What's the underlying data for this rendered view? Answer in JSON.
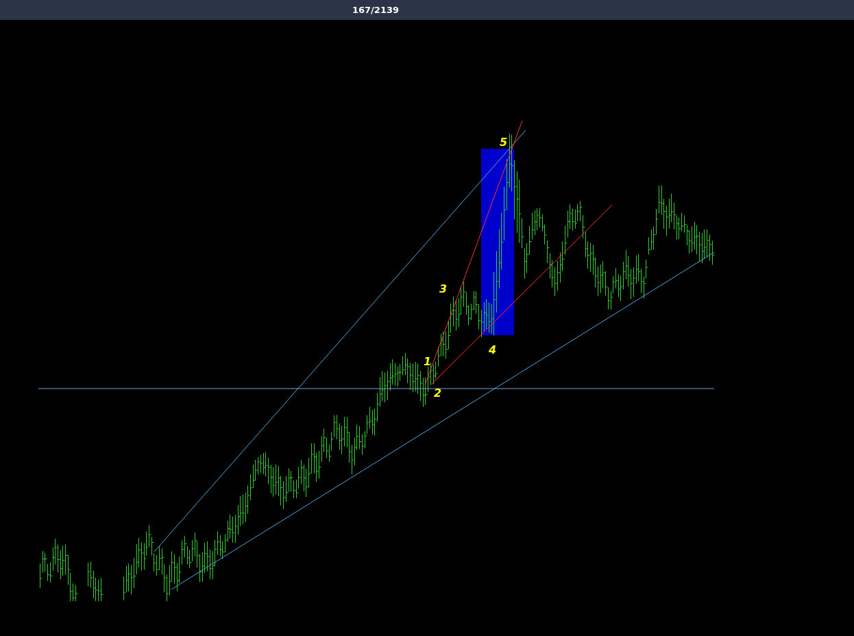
{
  "header": {
    "counter": "167/2139"
  },
  "chart": {
    "wave_labels": [
      {
        "text": "1"
      },
      {
        "text": "2"
      },
      {
        "text": "3"
      },
      {
        "text": "4"
      },
      {
        "text": "5"
      }
    ]
  }
}
